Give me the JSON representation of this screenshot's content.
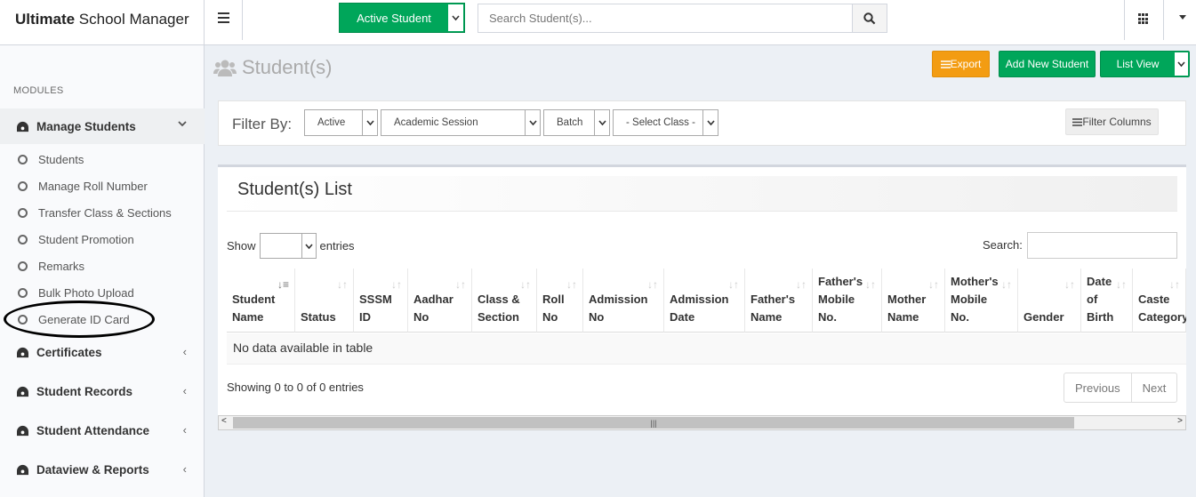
{
  "app": {
    "title_bold": "Ultimate",
    "title_rest": " School Manager"
  },
  "sidebar": {
    "section_label": "MODULES",
    "manage_students": {
      "label": "Manage Students",
      "chevron": "⌄"
    },
    "subitems": [
      "Students",
      "Manage Roll Number",
      "Transfer Class & Sections",
      "Student Promotion",
      "Remarks",
      "Bulk Photo Upload",
      "Generate ID Card"
    ],
    "menus": [
      "Certificates",
      "Student Records",
      "Student Attendance",
      "Dataview & Reports"
    ],
    "collapsed_chevron": "‹"
  },
  "topbar": {
    "student_status_button": "Active Student",
    "search_placeholder": "Search Student(s)...",
    "icons": [
      "hamburger-icon",
      "search-icon",
      "apps-grid-icon",
      "caret-down-icon"
    ]
  },
  "page": {
    "title": "Student(s)"
  },
  "actions": {
    "export": "Export",
    "add_new": "Add New Student",
    "list_view": "List View"
  },
  "filter": {
    "label": "Filter By:",
    "status": "Active",
    "session": "Academic Session",
    "batch": "Batch",
    "klass": "- Select Class -",
    "filter_columns": "Filter Columns"
  },
  "list": {
    "title": "Student(s) List",
    "show_label": "Show",
    "entries_label": "entries",
    "search_label": "Search:",
    "columns": [
      [
        "Student",
        "Name"
      ],
      [
        "Status"
      ],
      [
        "SSSM",
        "ID"
      ],
      [
        "Aadhar",
        "No"
      ],
      [
        "Class &",
        "Section"
      ],
      [
        "Roll",
        "No"
      ],
      [
        "Admission",
        "No"
      ],
      [
        "Admission",
        "Date"
      ],
      [
        "Father's",
        "Name"
      ],
      [
        "Father's",
        "Mobile",
        "No."
      ],
      [
        "Mother",
        "Name"
      ],
      [
        "Mother's",
        "Mobile",
        "No."
      ],
      [
        "Gender"
      ],
      [
        "Date",
        "of",
        "Birth"
      ],
      [
        "Caste",
        "Category"
      ]
    ],
    "empty_message": "No data available in table",
    "info": "Showing 0 to 0 of 0 entries",
    "prev": "Previous",
    "next": "Next"
  }
}
